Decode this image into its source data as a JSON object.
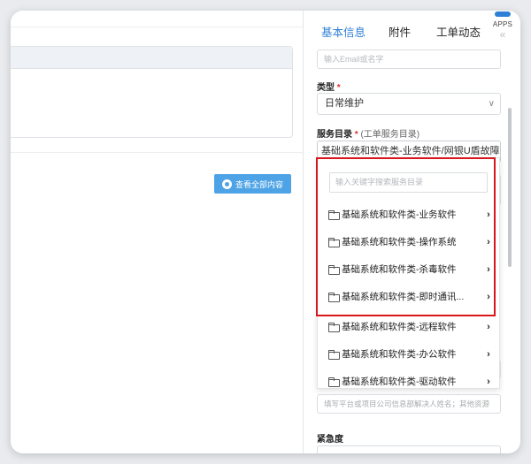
{
  "left_panel": {
    "view_all_label": "查看全部内容"
  },
  "tabs": [
    {
      "label": "基本信息",
      "active": true
    },
    {
      "label": "附件",
      "active": false
    },
    {
      "label": "工单动态",
      "active": false
    }
  ],
  "apps": {
    "label": "APPS"
  },
  "form": {
    "email_placeholder": "输入Email或名字",
    "type_label": "类型",
    "type_required": "*",
    "type_value": "日常维护",
    "service_label": "服务目录",
    "service_required": "*",
    "service_hint": "(工单服务目录)",
    "service_value": "基础系统和软件类-业务软件/网银U盾故障",
    "contact_placeholder": "填写平台或项目公司信息部解决人姓名；其他资源",
    "urgency_label": "紧急度"
  },
  "dropdown": {
    "search_placeholder": "输入关键字搜索服务目录",
    "items": [
      "基础系统和软件类-业务软件",
      "基础系统和软件类-操作系统",
      "基础系统和软件类-杀毒软件",
      "基础系统和软件类-即时通讯...",
      "基础系统和软件类-远程软件",
      "基础系统和软件类-办公软件",
      "基础系统和软件类-驱动软件"
    ]
  },
  "colors": {
    "accent": "#2e7fd6",
    "button": "#4ea3e6",
    "highlight": "#d8161b",
    "required": "#e03030"
  },
  "icons": {
    "view": "eye-icon",
    "folder": "folder-icon",
    "chevron": "chevron-right-icon",
    "select_arrow": "chevron-down-icon",
    "collapse": "double-chevron-left-icon"
  }
}
